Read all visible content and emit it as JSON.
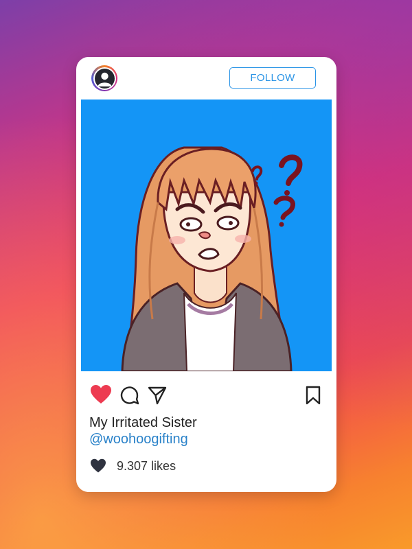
{
  "post": {
    "follow_label": "FOLLOW",
    "caption": "My Irritated Sister",
    "handle": "@woohoogifting",
    "likes_count": "9.307",
    "likes_word": "likes",
    "liked": true
  },
  "icons": {
    "avatar": "user-icon",
    "like": "heart-icon",
    "comment": "comment-icon",
    "share": "share-icon",
    "save": "bookmark-icon",
    "likes": "heart-icon"
  },
  "colors": {
    "follow_accent": "#2a94e6",
    "handle": "#2a82c9",
    "like_active": "#ed3b51",
    "photo_background": "#1495f6",
    "question_marks": "#7a1420"
  }
}
